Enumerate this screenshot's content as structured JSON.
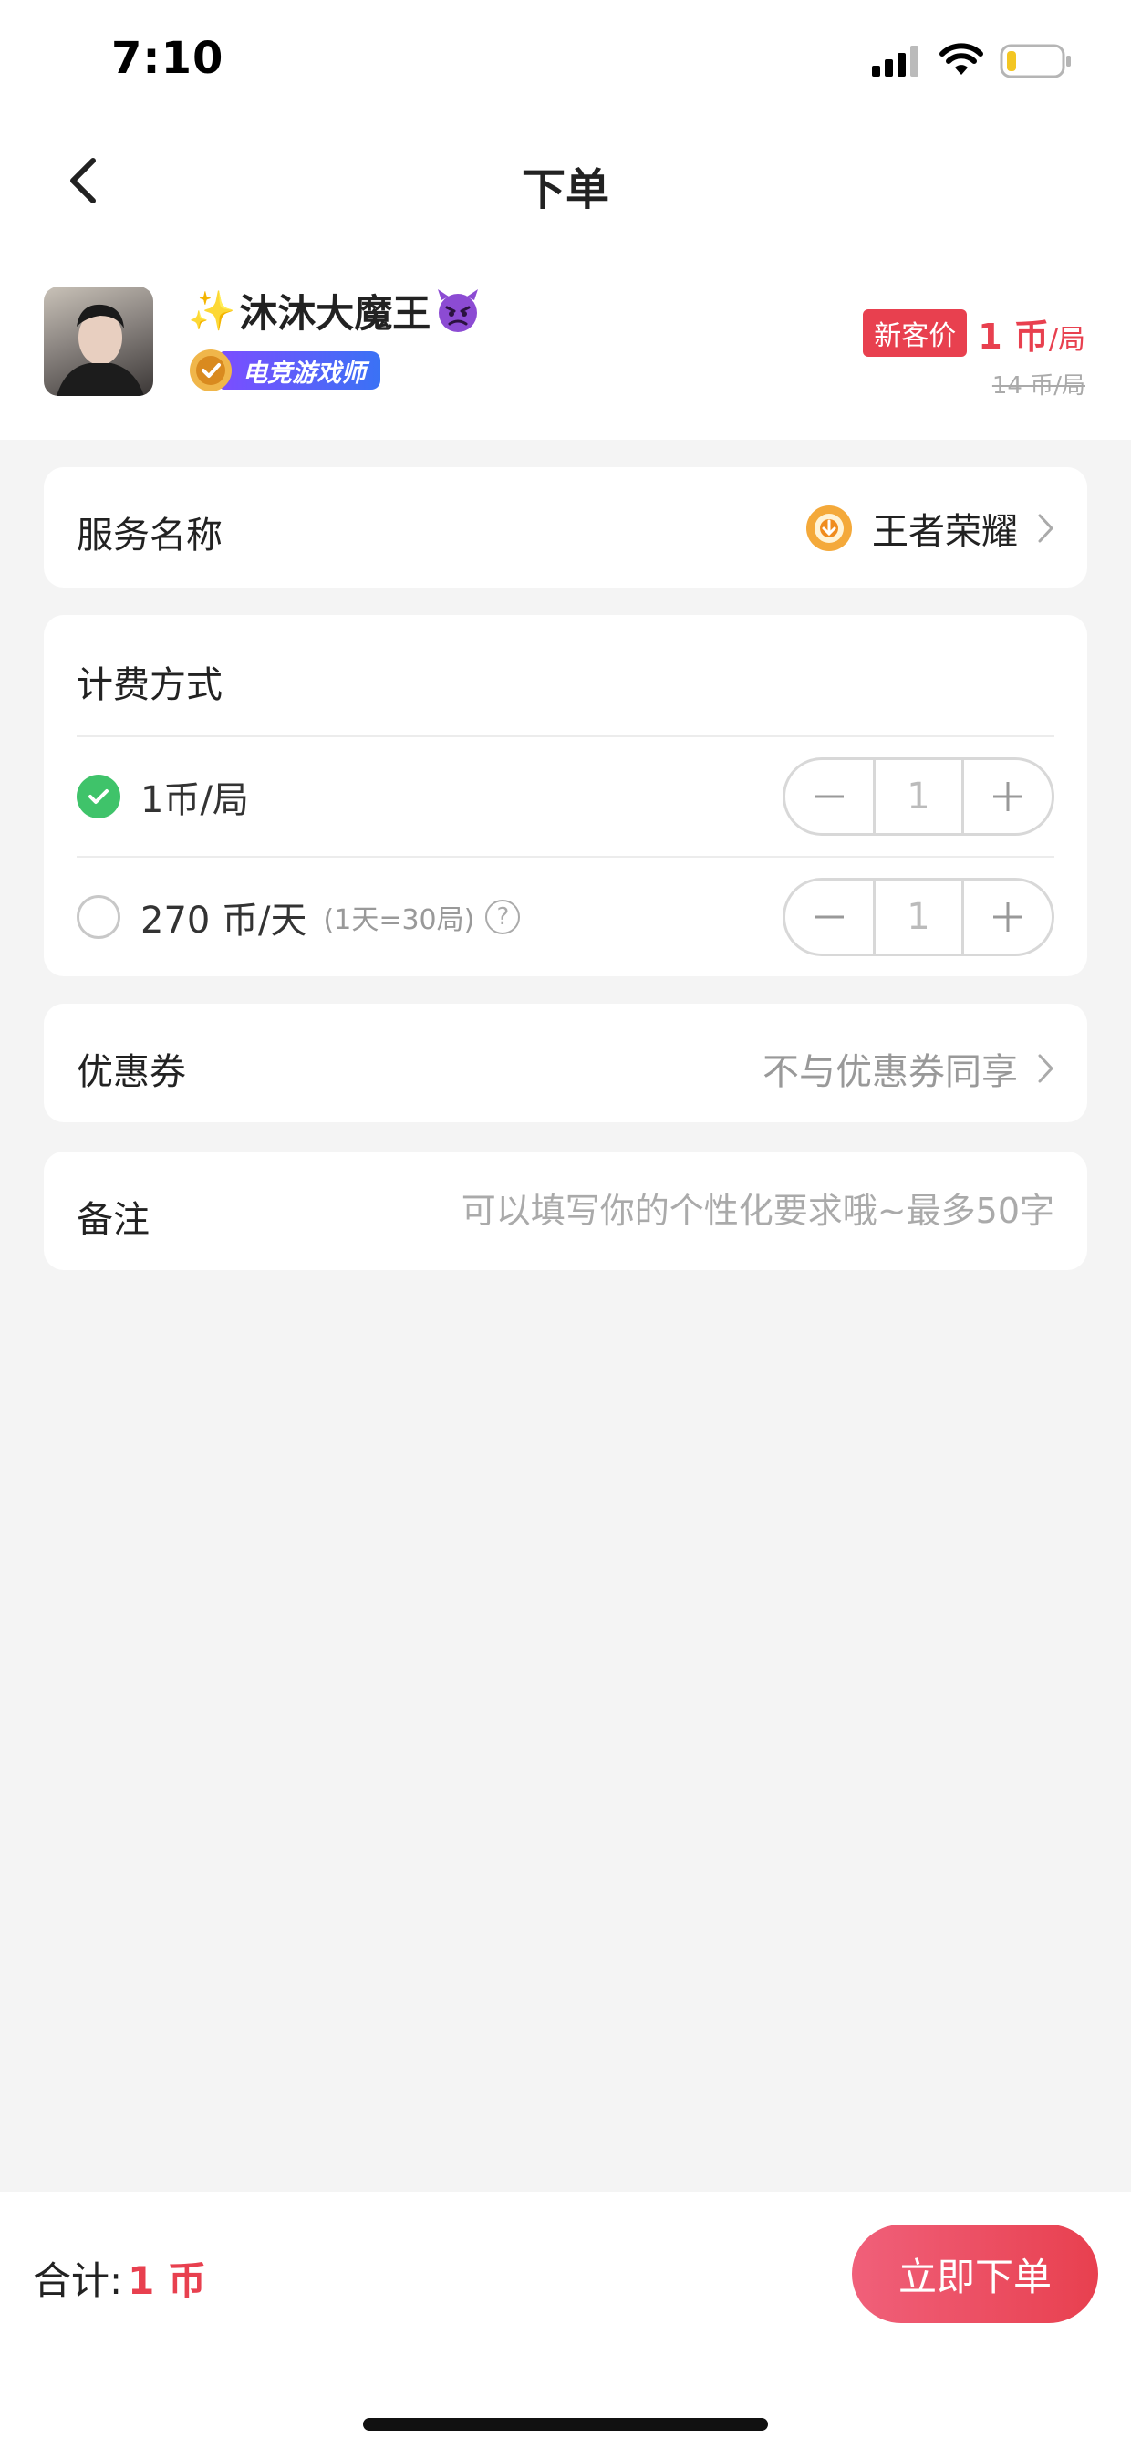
{
  "status_bar": {
    "time": "7:10"
  },
  "nav": {
    "title": "下单"
  },
  "profile": {
    "name": "沐沐大魔王",
    "badge": "电竞游戏师",
    "new_tag": "新客价",
    "price": "1 币",
    "price_unit": "/局",
    "old_price": "14 币/局"
  },
  "service": {
    "label": "服务名称",
    "value": "王者荣耀"
  },
  "billing": {
    "label": "计费方式",
    "options": [
      {
        "label": "1币/局",
        "note": "",
        "quantity": "1",
        "selected": true
      },
      {
        "label": "270 币/天",
        "note": "(1天=30局)",
        "quantity": "1",
        "selected": false
      }
    ]
  },
  "coupon": {
    "label": "优惠券",
    "value": "不与优惠券同享"
  },
  "remark": {
    "label": "备注",
    "placeholder": "可以填写你的个性化要求哦~最多50字"
  },
  "footer": {
    "total_label": "合计:",
    "total_value": "1 币",
    "order_button": "立即下单"
  },
  "colors": {
    "accent": "#e8404f",
    "check": "#3fc36a",
    "badge_start": "#7c4dff",
    "badge_end": "#3a72f5"
  }
}
